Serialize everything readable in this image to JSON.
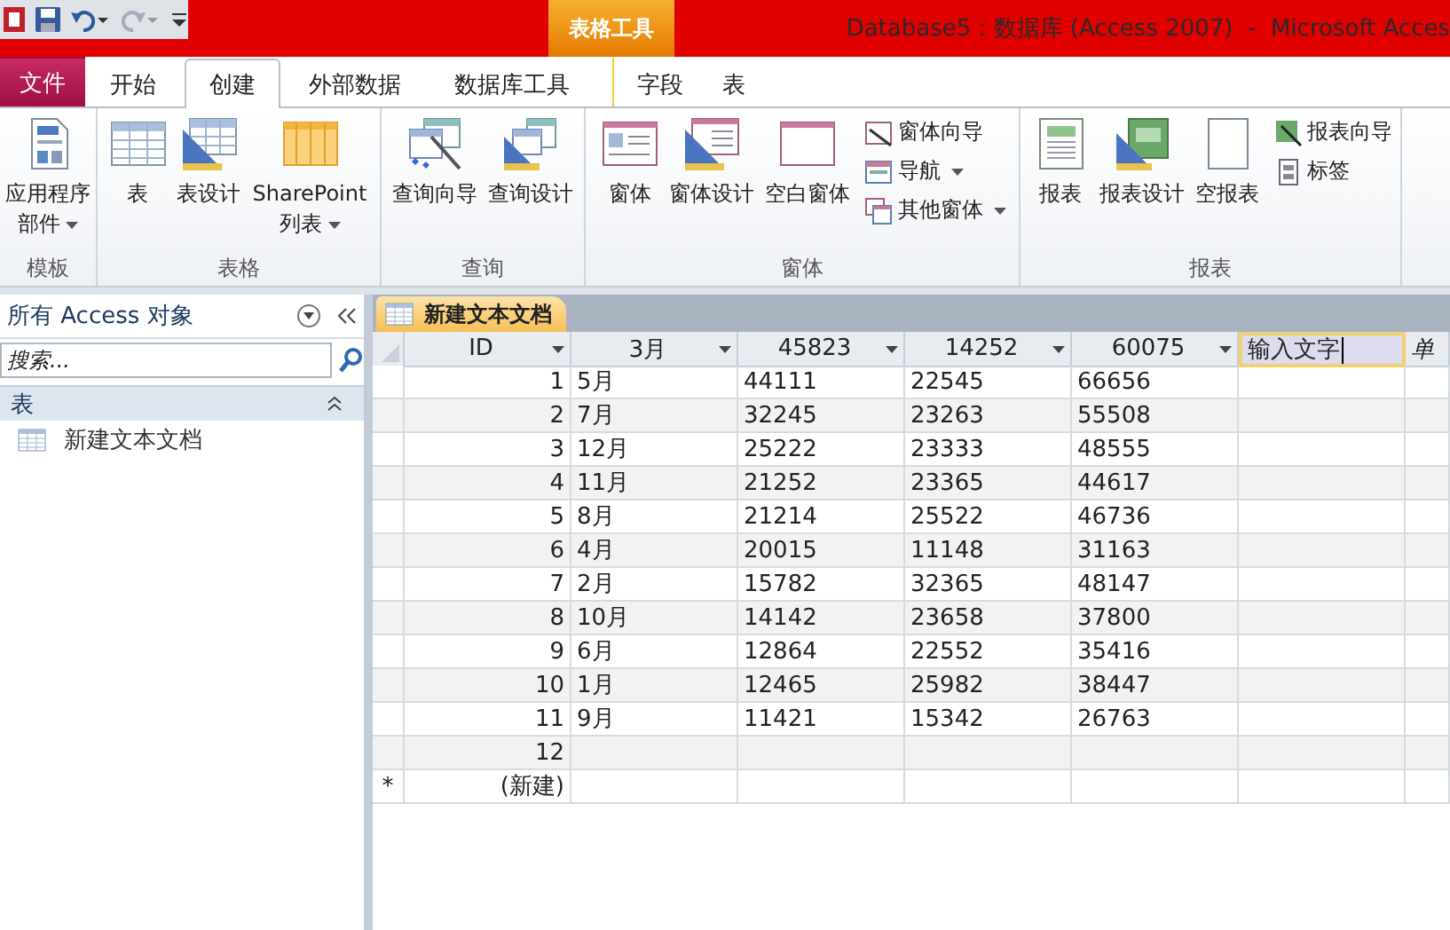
{
  "title_bar": {
    "title": "Database5 : 数据库 (Access 2007)  -  Microsoft Acces",
    "contextual_group": "表格工具"
  },
  "ribbon_tabs": [
    {
      "label": "文件",
      "kind": "file",
      "selected": false
    },
    {
      "label": "开始",
      "kind": "normal",
      "selected": false
    },
    {
      "label": "创建",
      "kind": "normal",
      "selected": true
    },
    {
      "label": "外部数据",
      "kind": "normal",
      "selected": false
    },
    {
      "label": "数据库工具",
      "kind": "normal",
      "selected": false
    },
    {
      "label": "字段",
      "kind": "contextual",
      "selected": false
    },
    {
      "label": "表",
      "kind": "contextual",
      "selected": false
    }
  ],
  "ribbon_groups": [
    {
      "label": "模板",
      "buttons": [
        {
          "label": "应用程序部件",
          "kind": "large",
          "dropdown": true
        }
      ]
    },
    {
      "label": "表格",
      "buttons": [
        {
          "label": "表",
          "kind": "large",
          "dropdown": false
        },
        {
          "label": "表设计",
          "kind": "large",
          "dropdown": false
        },
        {
          "label": "SharePoint列表",
          "kind": "large",
          "dropdown": true
        }
      ]
    },
    {
      "label": "查询",
      "buttons": [
        {
          "label": "查询向导",
          "kind": "large",
          "dropdown": false
        },
        {
          "label": "查询设计",
          "kind": "large",
          "dropdown": false
        }
      ]
    },
    {
      "label": "窗体",
      "buttons": [
        {
          "label": "窗体",
          "kind": "large",
          "dropdown": false
        },
        {
          "label": "窗体设计",
          "kind": "large",
          "dropdown": false
        },
        {
          "label": "空白窗体",
          "kind": "large",
          "dropdown": false
        },
        {
          "label": "窗体向导",
          "kind": "small",
          "dropdown": false
        },
        {
          "label": "导航",
          "kind": "small",
          "dropdown": true
        },
        {
          "label": "其他窗体",
          "kind": "small",
          "dropdown": true
        }
      ]
    },
    {
      "label": "报表",
      "buttons": [
        {
          "label": "报表",
          "kind": "large",
          "dropdown": false
        },
        {
          "label": "报表设计",
          "kind": "large",
          "dropdown": false
        },
        {
          "label": "空报表",
          "kind": "large",
          "dropdown": false
        },
        {
          "label": "报表向导",
          "kind": "small",
          "dropdown": false
        },
        {
          "label": "标签",
          "kind": "small",
          "dropdown": false
        }
      ]
    }
  ],
  "navigation_pane": {
    "title": "所有 Access 对象",
    "search": {
      "placeholder": "搜索..."
    },
    "groups": [
      {
        "label": "表",
        "expanded": true,
        "items": [
          {
            "label": "新建文本文档",
            "selected": false
          }
        ]
      }
    ]
  },
  "document_tabs": [
    {
      "label": "新建文本文档",
      "selected": true
    }
  ],
  "datasheet": {
    "columns": [
      {
        "label": "ID",
        "kind": "field"
      },
      {
        "label": "3月",
        "kind": "field"
      },
      {
        "label": "45823",
        "kind": "field"
      },
      {
        "label": "14252",
        "kind": "field"
      },
      {
        "label": "60075",
        "kind": "field"
      },
      {
        "label": "输入文字",
        "kind": "editing"
      },
      {
        "label": "单",
        "kind": "add"
      }
    ],
    "rows": [
      {
        "cells": [
          "1",
          "5月",
          "44111",
          "22545",
          "66656"
        ]
      },
      {
        "cells": [
          "2",
          "7月",
          "32245",
          "23263",
          "55508"
        ]
      },
      {
        "cells": [
          "3",
          "12月",
          "25222",
          "23333",
          "48555"
        ]
      },
      {
        "cells": [
          "4",
          "11月",
          "21252",
          "23365",
          "44617"
        ]
      },
      {
        "cells": [
          "5",
          "8月",
          "21214",
          "25522",
          "46736"
        ]
      },
      {
        "cells": [
          "6",
          "4月",
          "20015",
          "11148",
          "31163"
        ]
      },
      {
        "cells": [
          "7",
          "2月",
          "15782",
          "32365",
          "48147"
        ]
      },
      {
        "cells": [
          "8",
          "10月",
          "14142",
          "23658",
          "37800"
        ]
      },
      {
        "cells": [
          "9",
          "6月",
          "12864",
          "22552",
          "35416"
        ]
      },
      {
        "cells": [
          "10",
          "1月",
          "12465",
          "25982",
          "38447"
        ]
      },
      {
        "cells": [
          "11",
          "9月",
          "11421",
          "15342",
          "26763"
        ]
      },
      {
        "cells": [
          "12",
          "",
          "",
          "",
          ""
        ]
      }
    ],
    "new_row": {
      "marker": "*",
      "label": "(新建)"
    }
  }
}
